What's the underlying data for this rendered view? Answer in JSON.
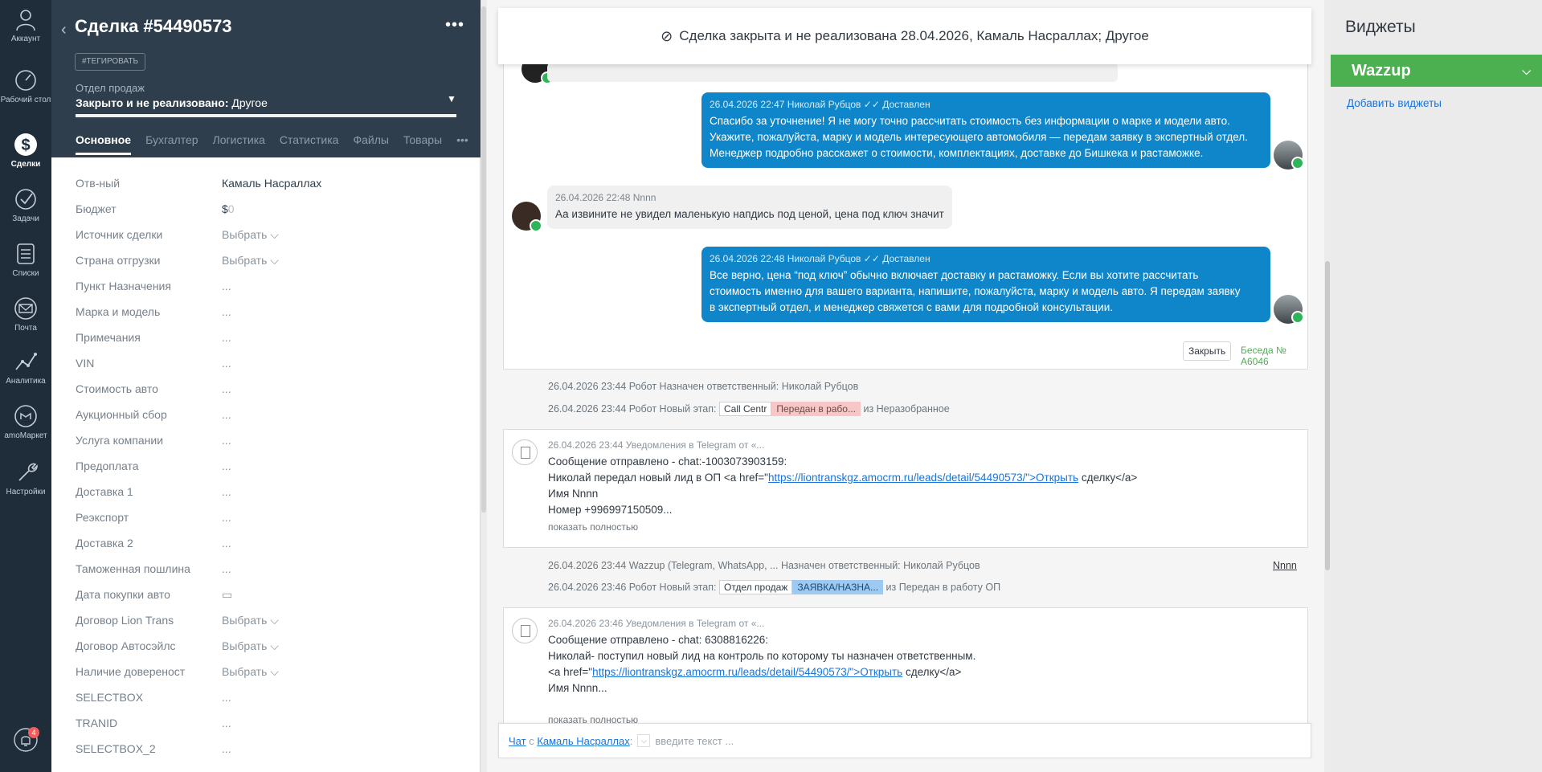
{
  "nav": {
    "items": [
      {
        "label": "Аккаунт",
        "icon": "account-icon"
      },
      {
        "label": "Рабочий стол",
        "icon": "dashboard-icon"
      },
      {
        "label": "Сделки",
        "icon": "deals-icon"
      },
      {
        "label": "Задачи",
        "icon": "tasks-icon"
      },
      {
        "label": "Списки",
        "icon": "lists-icon"
      },
      {
        "label": "Почта",
        "icon": "mail-icon"
      },
      {
        "label": "Аналитика",
        "icon": "analytics-icon"
      },
      {
        "label": "amoМаркет",
        "icon": "market-icon"
      },
      {
        "label": "Настройки",
        "icon": "settings-icon"
      }
    ],
    "notifications_count": "4"
  },
  "lead": {
    "title": "Сделка #54490573",
    "tag_button": "#ТЕГИРОВАТЬ",
    "pipeline": "Отдел продаж",
    "stage_bold": "Закрыто и не реализовано:",
    "stage_rest": " Другое",
    "tabs": [
      "Основное",
      "Бухгалтер",
      "Логистика",
      "Статистика",
      "Файлы",
      "Товары"
    ],
    "fields": [
      {
        "label": "Отв-ный",
        "value": "Камаль Насраллах"
      },
      {
        "label": "Бюджет",
        "value": "$",
        "extra": "0"
      },
      {
        "label": "Источник сделки",
        "value": "Выбрать ⌵"
      },
      {
        "label": "Страна отгрузки",
        "value": "Выбрать ⌵"
      },
      {
        "label": "Пункт Назначения",
        "value": "..."
      },
      {
        "label": "Марка и модель",
        "value": "..."
      },
      {
        "label": "Примечания",
        "value": "..."
      },
      {
        "label": "VIN",
        "value": "..."
      },
      {
        "label": "Стоимость авто",
        "value": "..."
      },
      {
        "label": "Аукционный сбор",
        "value": "..."
      },
      {
        "label": "Услуга компании",
        "value": "..."
      },
      {
        "label": "Предоплата",
        "value": "..."
      },
      {
        "label": "Доставка 1",
        "value": "..."
      },
      {
        "label": "Реэкспорт",
        "value": "..."
      },
      {
        "label": "Доставка 2",
        "value": "..."
      },
      {
        "label": "Таможенная пошлина",
        "value": "..."
      },
      {
        "label": "Дата покупки авто",
        "value": "▭"
      },
      {
        "label": "Договор Lion Trans",
        "value": "Выбрать ⌵"
      },
      {
        "label": "Договор Автосэйлс",
        "value": "Выбрать ⌵"
      },
      {
        "label": "Наличие довереност",
        "value": "Выбрать ⌵"
      },
      {
        "label": "SELECTBOX",
        "value": "..."
      },
      {
        "label": "TRANID",
        "value": "..."
      },
      {
        "label": "SELECTBOX_2",
        "value": "..."
      }
    ]
  },
  "feed": {
    "closed_banner": "Сделка закрыта и не реализована 28.04.2026, Камаль Насраллах; Другое",
    "messages": [
      {
        "meta": "26.04.2026 22:47 Николай Рубцов ✓✓ Доставлен",
        "lines": [
          "Спасибо за уточнение! Я не могу точно рассчитать стоимость без информации о марке и модели авто.",
          "Укажите, пожалуйста, марку и модель интересующего автомобиля — передам заявку в экспертный отдел.",
          "Менеджер подробно расскажет о стоимости, комплектациях, доставке до Бишкека и растаможке."
        ]
      },
      {
        "meta": "26.04.2026 22:48 Nnnn",
        "lines": [
          "Аа извините не увидел маленькую напдись под ценой, цена под ключ значит"
        ]
      },
      {
        "meta": "26.04.2026 22:48 Николай Рубцов ✓✓ Доставлен",
        "lines": [
          "Все верно, цена “под ключ” обычно включает доставку и растаможку. Если вы хотите рассчитать",
          "стоимость именно для вашего варианта, напишите, пожалуйста, марку и модель авто. Я передам заявку",
          "в экспертный отдел, и менеджер свяжется с вами для подробной консультации."
        ]
      }
    ],
    "close_button": "Закрыть",
    "conversation_link": "Беседа № A6046",
    "sys1": "26.04.2026 23:44 Робот Назначен ответственный: Николай Рубцов",
    "sys2_prefix": "26.04.2026 23:44 Робот Новый этап:",
    "sys2_pipeline": "Call Centr",
    "sys2_stage": "Передан в рабо...",
    "sys2_suffix": "из Неразобранное",
    "note1": {
      "meta": "26.04.2026 23:44 Уведомления в Telegram от «...",
      "line1": "Сообщение отправлено - chat:-1003073903159:",
      "line2_prefix": "Николай передал новый лид в ОП <a href=\"",
      "link": "https://liontranskgz.amocrm.ru/leads/detail/54490573/\">Открыть",
      "line2_suffix": " сделку</a>",
      "line3": "Имя Nnnn",
      "line4": "Номер +996997150509...",
      "more": "показать полностью"
    },
    "sys3": "26.04.2026 23:44 Wazzup (Telegram, WhatsApp, ... Назначен ответственный: Николай Рубцов",
    "sys3_user": "Nnnn",
    "sys4_prefix": "26.04.2026 23:46 Робот Новый этап:",
    "sys4_pipeline": "Отдел продаж",
    "sys4_stage": "ЗАЯВКА/НАЗНА...",
    "sys4_suffix": "из Передан в работу ОП",
    "note2": {
      "meta": "26.04.2026 23:46 Уведомления в Telegram от «...",
      "line1": "Сообщение отправлено - chat: 6308816226:",
      "line2": "Николай- поступил новый лид на контроль по которому ты назначен ответственным.",
      "line3_prefix": "<a href=\"",
      "link": "https://liontranskgz.amocrm.ru/leads/detail/54490573/\">Открыть",
      "line3_suffix": " сделку</a>",
      "line4": "Имя Nnnn...",
      "more": "показать полностью"
    },
    "input": {
      "chat_label": "Чат",
      "with": " с ",
      "contact": "Камаль Насраллах",
      "colon": ":",
      "placeholder": "введите текст ..."
    }
  },
  "widgets": {
    "title": "Виджеты",
    "wazzup": "Wazzup",
    "add": "Добавить виджеты"
  }
}
